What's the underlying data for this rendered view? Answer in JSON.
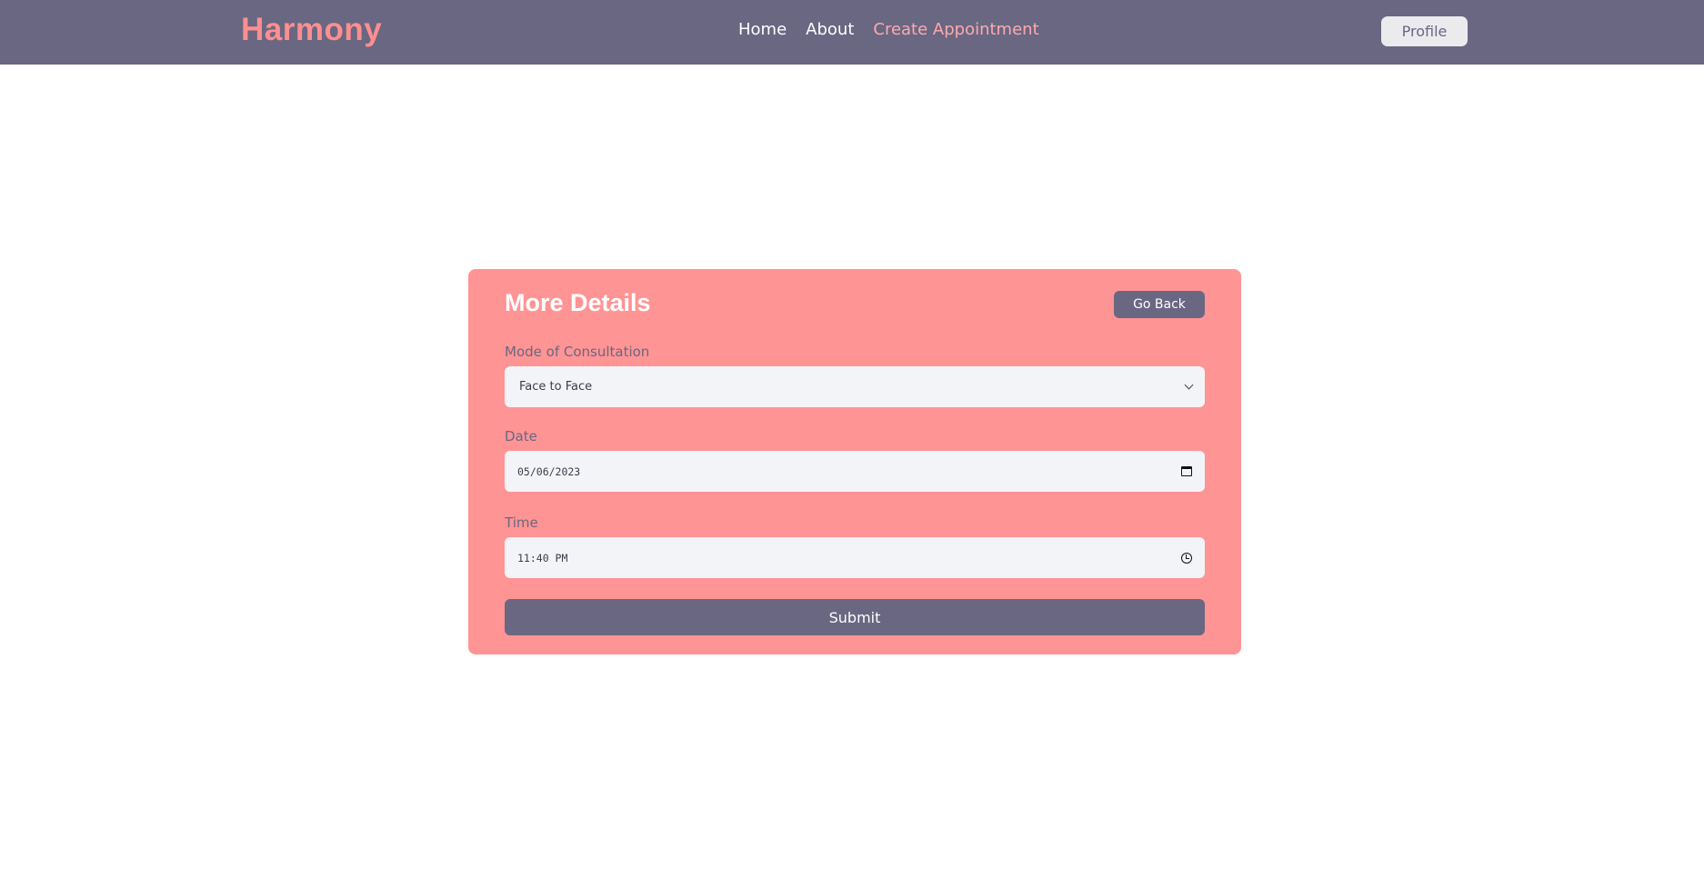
{
  "header": {
    "brand": "Harmony",
    "nav": [
      {
        "label": "Home"
      },
      {
        "label": "About"
      },
      {
        "label": "Create Appointment"
      }
    ],
    "profile_label": "Profile"
  },
  "form": {
    "title": "More Details",
    "go_back_label": "Go Back",
    "mode": {
      "label": "Mode of Consultation",
      "value": "Face to Face"
    },
    "date": {
      "label": "Date",
      "value": "05/06/2023"
    },
    "time": {
      "label": "Time",
      "value": "11:40 PM"
    },
    "submit_label": "Submit"
  },
  "colors": {
    "navbar": "#696782",
    "brand": "#ff8f8f",
    "card": "#ff9494",
    "active_link": "#ffa9ad"
  },
  "icons": {
    "select": "chevron-down-icon",
    "date": "calendar-icon",
    "time": "clock-icon"
  }
}
